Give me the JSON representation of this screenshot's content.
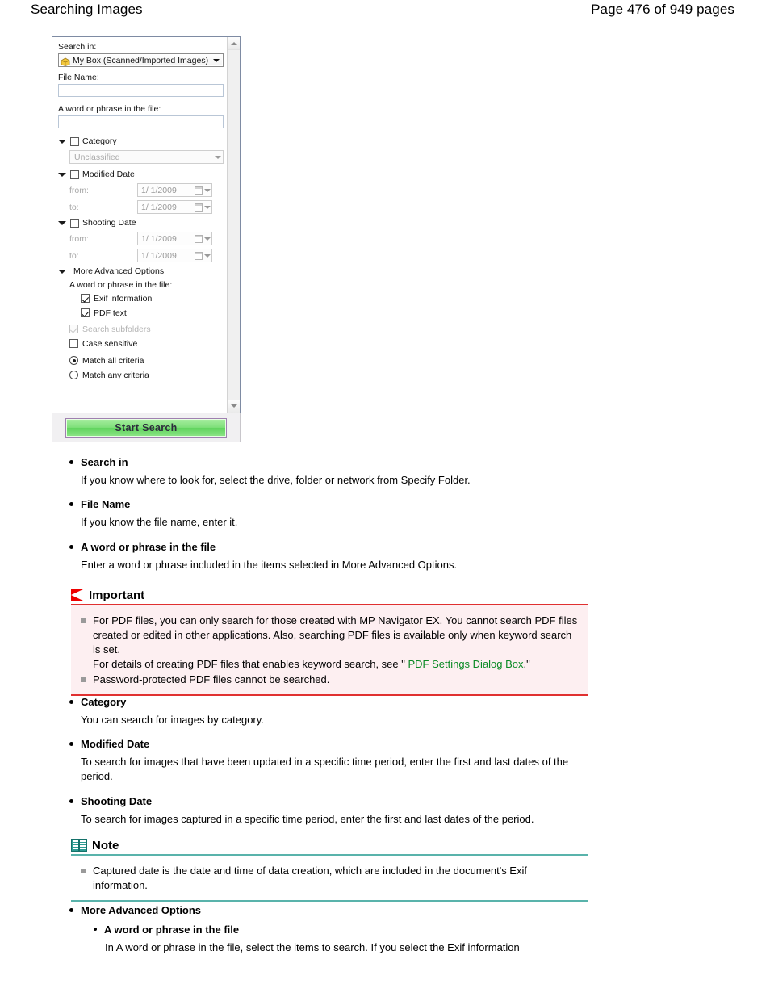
{
  "header": {
    "title": "Searching Images",
    "page_label": "Page 476 of 949 pages"
  },
  "dialog": {
    "search_in_label": "Search in:",
    "search_in_value": "My Box (Scanned/Imported Images)",
    "search_in_icon": "box-icon",
    "file_name_label": "File Name:",
    "file_name_value": "",
    "word_phrase_label": "A word or phrase in the file:",
    "word_phrase_value": "",
    "category_label": "Category",
    "category_value": "Unclassified",
    "modified_date_label": "Modified Date",
    "shooting_date_label": "Shooting Date",
    "from_label": "from:",
    "to_label": "to:",
    "date_value": "1/ 1/2009",
    "more_advanced_label": "More Advanced Options",
    "advanced_word_phrase_label": "A word or phrase in the file:",
    "exif_label": "Exif information",
    "pdf_text_label": "PDF text",
    "search_subfolders_label": "Search subfolders",
    "case_sensitive_label": "Case sensitive",
    "match_all_label": "Match all criteria",
    "match_any_label": "Match any criteria",
    "start_search_label": "Start Search",
    "button_border_color": "#9f7fb0",
    "button_fill_color": "#7fe07a"
  },
  "sections": {
    "search_in": {
      "heading": "Search in",
      "text": "If you know where to look for, select the drive, folder or network from Specify Folder."
    },
    "file_name": {
      "heading": "File Name",
      "text": "If you know the file name, enter it."
    },
    "word_phrase": {
      "heading": "A word or phrase in the file",
      "text": "Enter a word or phrase included in the items selected in More Advanced Options."
    },
    "category": {
      "heading": "Category",
      "text": "You can search for images by category."
    },
    "modified_date": {
      "heading": "Modified Date",
      "text": "To search for images that have been updated in a specific time period, enter the first and last dates of the period."
    },
    "shooting_date": {
      "heading": "Shooting Date",
      "text": "To search for images captured in a specific time period, enter the first and last dates of the period."
    },
    "more_advanced": {
      "heading": "More Advanced Options",
      "sub_heading": "A word or phrase in the file",
      "text": "In A word or phrase in the file, select the items to search. If you select the Exif information"
    }
  },
  "important": {
    "title": "Important",
    "icon": "red-flag-icon",
    "accent_color": "#e03030",
    "background_color": "#fdeff1",
    "item1_part1": "For PDF files, you can only search for those created with MP Navigator EX. You cannot search PDF files created or edited in other applications. Also, searching PDF files is available only when keyword search is set.",
    "item1_part2_prefix": "For details of creating PDF files that enables keyword search, see \" ",
    "item1_link": "PDF Settings Dialog Box",
    "item1_part2_suffix": ".\"",
    "item2": "Password-protected PDF files cannot be searched.",
    "link_color": "#0a8a24"
  },
  "note": {
    "title": "Note",
    "icon": "book-icon",
    "accent_color": "#59b3ab",
    "item1": "Captured date is the date and time of data creation, which are included in the document's Exif information."
  }
}
